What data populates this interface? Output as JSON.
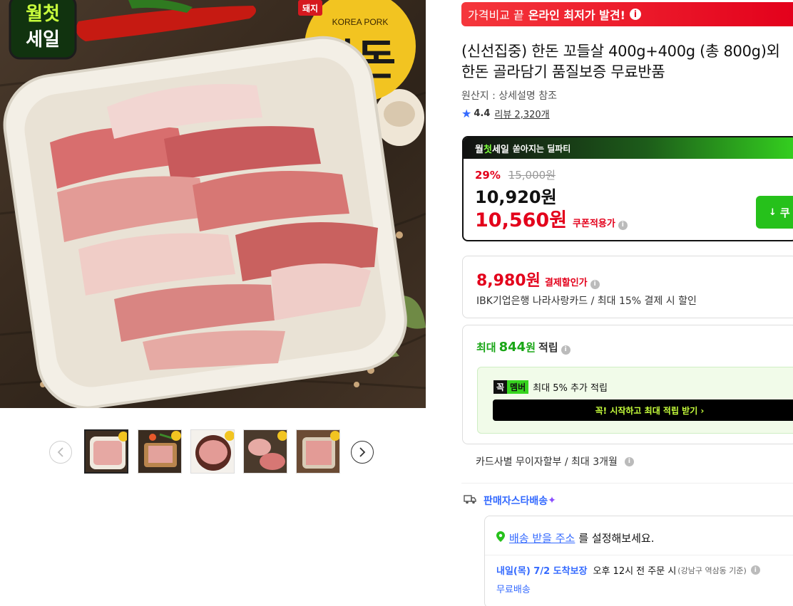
{
  "gallery": {
    "sale_badge": "월첫세일",
    "brand_badge_top": "돼지",
    "brand_seal_en": "KOREA PORK",
    "brand_seal_ko": "한돈",
    "thumbnails": [
      "thumbnail-1",
      "thumbnail-2",
      "thumbnail-3",
      "thumbnail-4",
      "thumbnail-5"
    ]
  },
  "promo": {
    "prefix": "가격비교 끝",
    "emphasis": "온라인 최저가 발견!",
    "icon": "info-icon"
  },
  "product": {
    "title": "(신선집중) 한돈 꼬들살 400g+400g (총 800g)외 한돈 골라담기 품질보증 무료반품",
    "origin": "원산지 : 상세설명 참조",
    "rating": "4.4",
    "reviews": "리뷰 2,320개"
  },
  "deal": {
    "header_prefix": "월",
    "header_chot": "첫",
    "header_suffix": "세일",
    "header_sub": "쏟아지는 딜파티",
    "discount_pct": "29%",
    "original_price": "15,000원",
    "sale_price": "10,920원",
    "coupon_price": "10,560원",
    "coupon_label": "쿠폰적용가",
    "coupon_button": "쿠"
  },
  "card_discount": {
    "price": "8,980원",
    "label": "결제할인가",
    "desc": "IBK기업은행 나라사랑카드 / 최대 15% 결제 시 할인"
  },
  "reward": {
    "prefix": "최대",
    "amount": "844",
    "unit": "원",
    "suffix": "적립",
    "kkok": "꼭",
    "member": "멤버",
    "member_text": "최대 5% 추가 적립",
    "member_button": "꼭! 시작하고 최대 적립 받기 ›"
  },
  "installment": "카드사별 무이자할부 / 최대 3개월",
  "delivery": {
    "head": "판매자스타배송",
    "address_link": "배송 받을 주소",
    "address_tail": "를 설정해보세요.",
    "guarantee": "내일(목) 7/2 도착보장",
    "order_by": "오후 12시 전 주문 시",
    "location": "(강남구 역삼동 기준)",
    "free": "무료배송"
  },
  "colors": {
    "accent_red": "#e3001b",
    "accent_green": "#26c11b",
    "accent_blue": "#346aff"
  }
}
